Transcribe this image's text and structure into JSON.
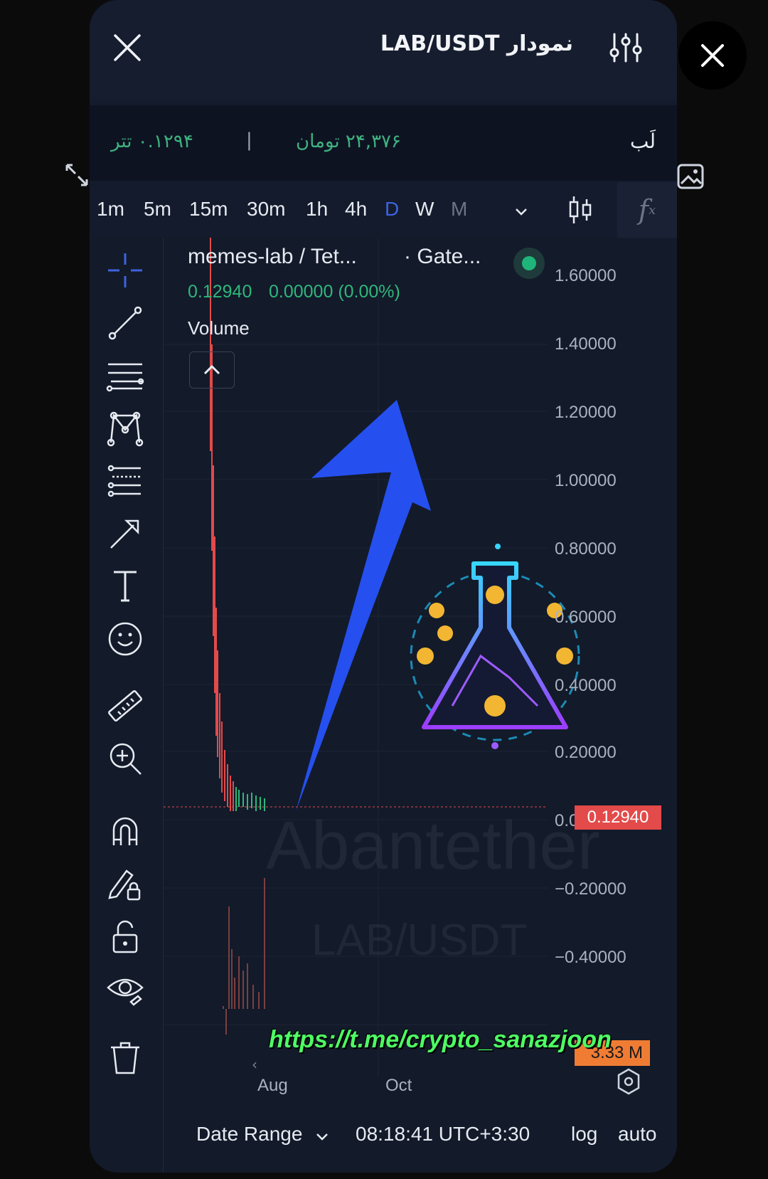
{
  "header": {
    "title": "LAB/USDT نمودار",
    "close_icon": "close-icon",
    "settings_icon": "sliders-icon"
  },
  "price_bar": {
    "usdt_price": "۰.۱۲۹۴ تتر",
    "separator": "|",
    "toman_price": "۲۴,۳۷۶ تومان",
    "asset_name": "لَب"
  },
  "timeframes": {
    "items": [
      "1m",
      "5m",
      "15m",
      "30m",
      "1h",
      "4h",
      "D",
      "W",
      "M"
    ],
    "active": "D",
    "disabled": "M"
  },
  "legend": {
    "symbol": "memes-lab / Tet...",
    "exchange": "· Gate...",
    "price": "0.12940",
    "change": "0.00000 (0.00%)",
    "volume_label": "Volume"
  },
  "y_axis": {
    "ticks": [
      "1.60000",
      "1.40000",
      "1.20000",
      "1.00000",
      "0.80000",
      "0.60000",
      "0.40000",
      "0.20000",
      "0.00000",
      "−0.20000",
      "−0.40000"
    ],
    "last_price_tag": "0.12940",
    "volume_tag": "3.33 M"
  },
  "x_axis": {
    "ticks": [
      "Aug",
      "Oct"
    ]
  },
  "bottom_bar": {
    "date_range": "Date Range",
    "time": "08:18:41 UTC+3:30",
    "log": "log",
    "auto": "auto"
  },
  "watermark": {
    "brand": "Abantether",
    "pair": "LAB/USDT"
  },
  "overlay": {
    "link": "https://t.me/crypto_sanazjoon"
  },
  "colors": {
    "up": "#2fb77b",
    "down": "#e34a4a",
    "accent": "#3d63dd",
    "volume_tag": "#f07c34"
  }
}
